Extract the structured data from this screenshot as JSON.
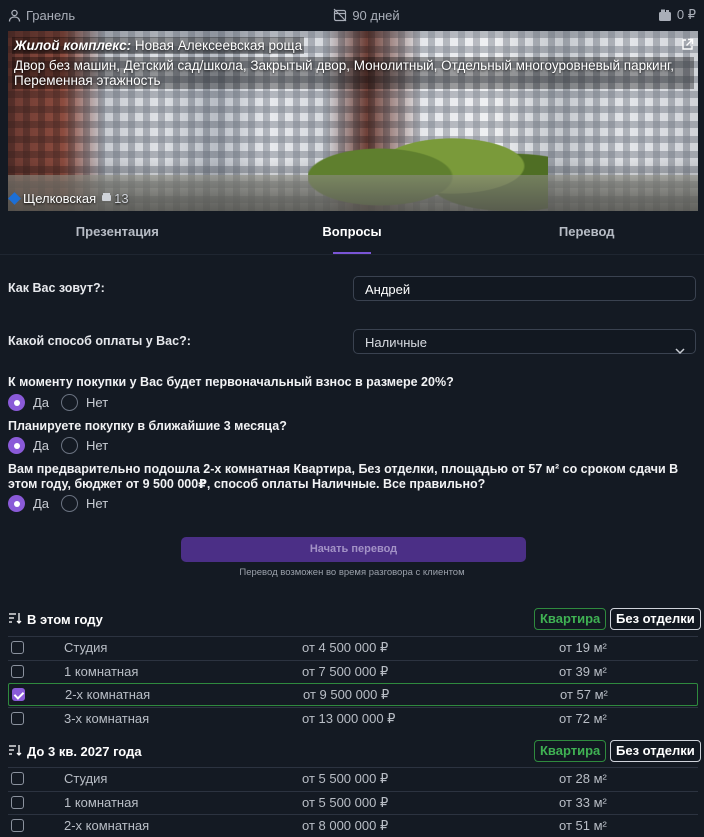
{
  "topbar": {
    "name": "Гранель",
    "days": "90 дней",
    "money": "0 ₽"
  },
  "hero": {
    "label": "Жилой комплекс:",
    "complex": "Новая Алексеевская роща",
    "features": "Двор без машин, Детский сад/школа, Закрытый двор, Монолитный, Отдельный многоуровневый паркинг, Переменная этажность",
    "metro": "Щелковская",
    "walk_minutes": "13"
  },
  "tabs": [
    {
      "label": "Презентация",
      "active": false
    },
    {
      "label": "Вопросы",
      "active": true
    },
    {
      "label": "Перевод",
      "active": false
    }
  ],
  "form": {
    "name_label": "Как Вас зовут?:",
    "name_value": "Андрей",
    "payment_label": "Какой способ оплаты у Вас?:",
    "payment_value": "Наличные"
  },
  "questions": [
    {
      "text": "К моменту покупки у Вас будет первоначальный взнос в размере 20%?",
      "yes": "Да",
      "no": "Нет",
      "answer": "yes"
    },
    {
      "text": "Планируете покупку в ближайшие 3 месяца?",
      "yes": "Да",
      "no": "Нет",
      "answer": "yes"
    },
    {
      "text": "Вам предварительно подошла 2-х комнатная Квартира, Без отделки, площадью от 57 м² со сроком сдачи В этом году, бюджет от 9 500 000₽, способ оплаты Наличные. Все правильно?",
      "yes": "Да",
      "no": "Нет",
      "answer": "yes"
    }
  ],
  "start_button": "Начать перевод",
  "start_hint": "Перевод возможен во время разговора с клиентом",
  "sections": [
    {
      "title": "В этом году",
      "chip_type": "Квартира",
      "chip_finish": "Без отделки",
      "rows": [
        {
          "type": "Студия",
          "price": "от 4 500 000 ₽",
          "area": "от 19 м²",
          "checked": false
        },
        {
          "type": "1 комнатная",
          "price": "от 7 500 000 ₽",
          "area": "от 39 м²",
          "checked": false
        },
        {
          "type": "2-х комнатная",
          "price": "от 9 500 000 ₽",
          "area": "от 57 м²",
          "checked": true
        },
        {
          "type": "3-х комнатная",
          "price": "от 13 000 000 ₽",
          "area": "от 72 м²",
          "checked": false
        }
      ]
    },
    {
      "title": "До 3 кв. 2027 года",
      "chip_type": "Квартира",
      "chip_finish": "Без отделки",
      "rows": [
        {
          "type": "Студия",
          "price": "от 5 500 000 ₽",
          "area": "от 28 м²",
          "checked": false
        },
        {
          "type": "1 комнатная",
          "price": "от 5 500 000 ₽",
          "area": "от 33 м²",
          "checked": false
        },
        {
          "type": "2-х комнатная",
          "price": "от 8 000 000 ₽",
          "area": "от 51 м²",
          "checked": false
        }
      ]
    }
  ],
  "colors": {
    "accent": "#8a5ad8",
    "green": "#3fb153",
    "background": "#141a23"
  }
}
